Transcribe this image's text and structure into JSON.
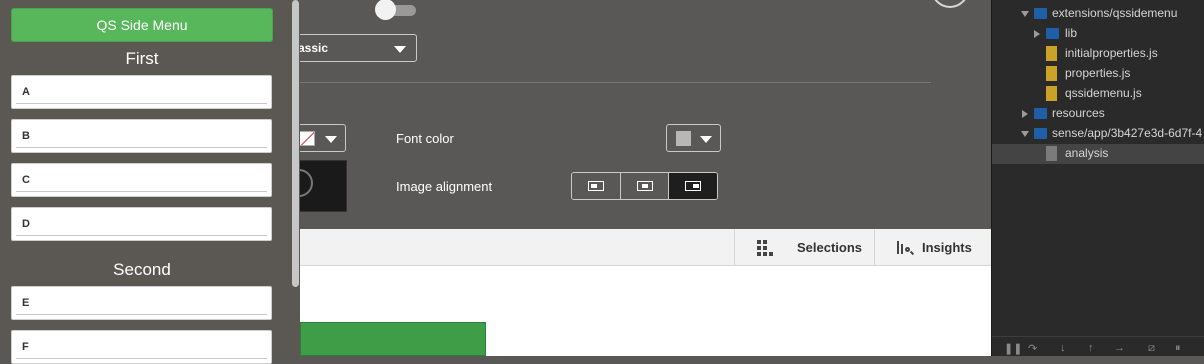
{
  "side_menu": {
    "title": "QS Side Menu",
    "groups": [
      {
        "heading": "First",
        "items": [
          "A",
          "B",
          "C",
          "D"
        ]
      },
      {
        "heading": "Second",
        "items": [
          "E",
          "F"
        ]
      }
    ]
  },
  "properties": {
    "theme_select_value": "assic",
    "font_color_label": "Font color",
    "image_alignment_label": "Image alignment",
    "image_alignment_options": [
      "left",
      "center",
      "right"
    ],
    "image_alignment_selected": "right",
    "font_color_swatch": "#b7b7b7",
    "accent_green": "#58b65b"
  },
  "toolbar": {
    "selections_label": "Selections",
    "insights_label": "Insights"
  },
  "devtools": {
    "tree": [
      {
        "label": "extensions/qssidemenu",
        "type": "folder",
        "expanded": true
      },
      {
        "label": "lib",
        "type": "folder",
        "expanded": false
      },
      {
        "label": "initialproperties.js",
        "type": "file"
      },
      {
        "label": "properties.js",
        "type": "file"
      },
      {
        "label": "qssidemenu.js",
        "type": "file"
      },
      {
        "label": "resources",
        "type": "folder",
        "expanded": false
      },
      {
        "label": "sense/app/3b427e3d-6d7f-4",
        "type": "folder",
        "expanded": true
      },
      {
        "label": "analysis",
        "type": "file-grey",
        "selected": true
      }
    ]
  }
}
